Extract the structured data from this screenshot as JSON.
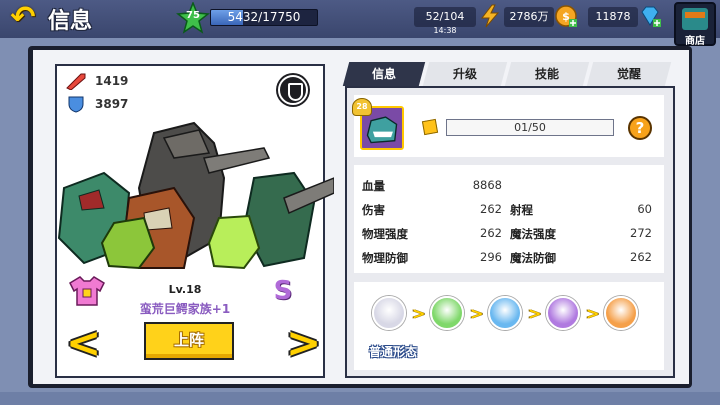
{
  "header": {
    "title": "信息",
    "player_level": "75",
    "exp_text": "5432/17750",
    "exp_progress": 0.306,
    "energy": "52/104",
    "energy_timer": "14:38",
    "gold": "2786万",
    "gems": "11878",
    "shop_label": "商店"
  },
  "hero": {
    "attack": "1419",
    "defense": "3897",
    "level": "Lv.18",
    "name": "蛮荒巨鳄家族+1",
    "rarity": "S",
    "deploy_label": "上阵"
  },
  "tabs": [
    {
      "label": "信息",
      "active": true
    },
    {
      "label": "升级",
      "active": false
    },
    {
      "label": "技能",
      "active": false
    },
    {
      "label": "觉醒",
      "active": false
    }
  ],
  "info": {
    "portrait_level": "28",
    "shards": "01/50",
    "help": "?"
  },
  "stats": {
    "hp_label": "血量",
    "hp": "8868",
    "dmg_label": "伤害",
    "dmg": "262",
    "range_label": "射程",
    "range": "60",
    "phys_power_label": "物理强度",
    "phys_power": "262",
    "magic_power_label": "魔法强度",
    "magic_power": "272",
    "phys_def_label": "物理防御",
    "phys_def": "296",
    "magic_def_label": "魔法防御",
    "magic_def": "262"
  },
  "evolution": {
    "label": "普通形态",
    "stages": [
      {
        "icon": "white-demon-icon",
        "color": "#d8d8e6"
      },
      {
        "icon": "green-demon-icon",
        "color": "#7fd86a"
      },
      {
        "icon": "blue-demon-icon",
        "color": "#6ab8f0"
      },
      {
        "icon": "purple-demon-icon",
        "color": "#b07ae0"
      },
      {
        "icon": "orange-demon-icon",
        "color": "#f5a04a"
      }
    ]
  }
}
